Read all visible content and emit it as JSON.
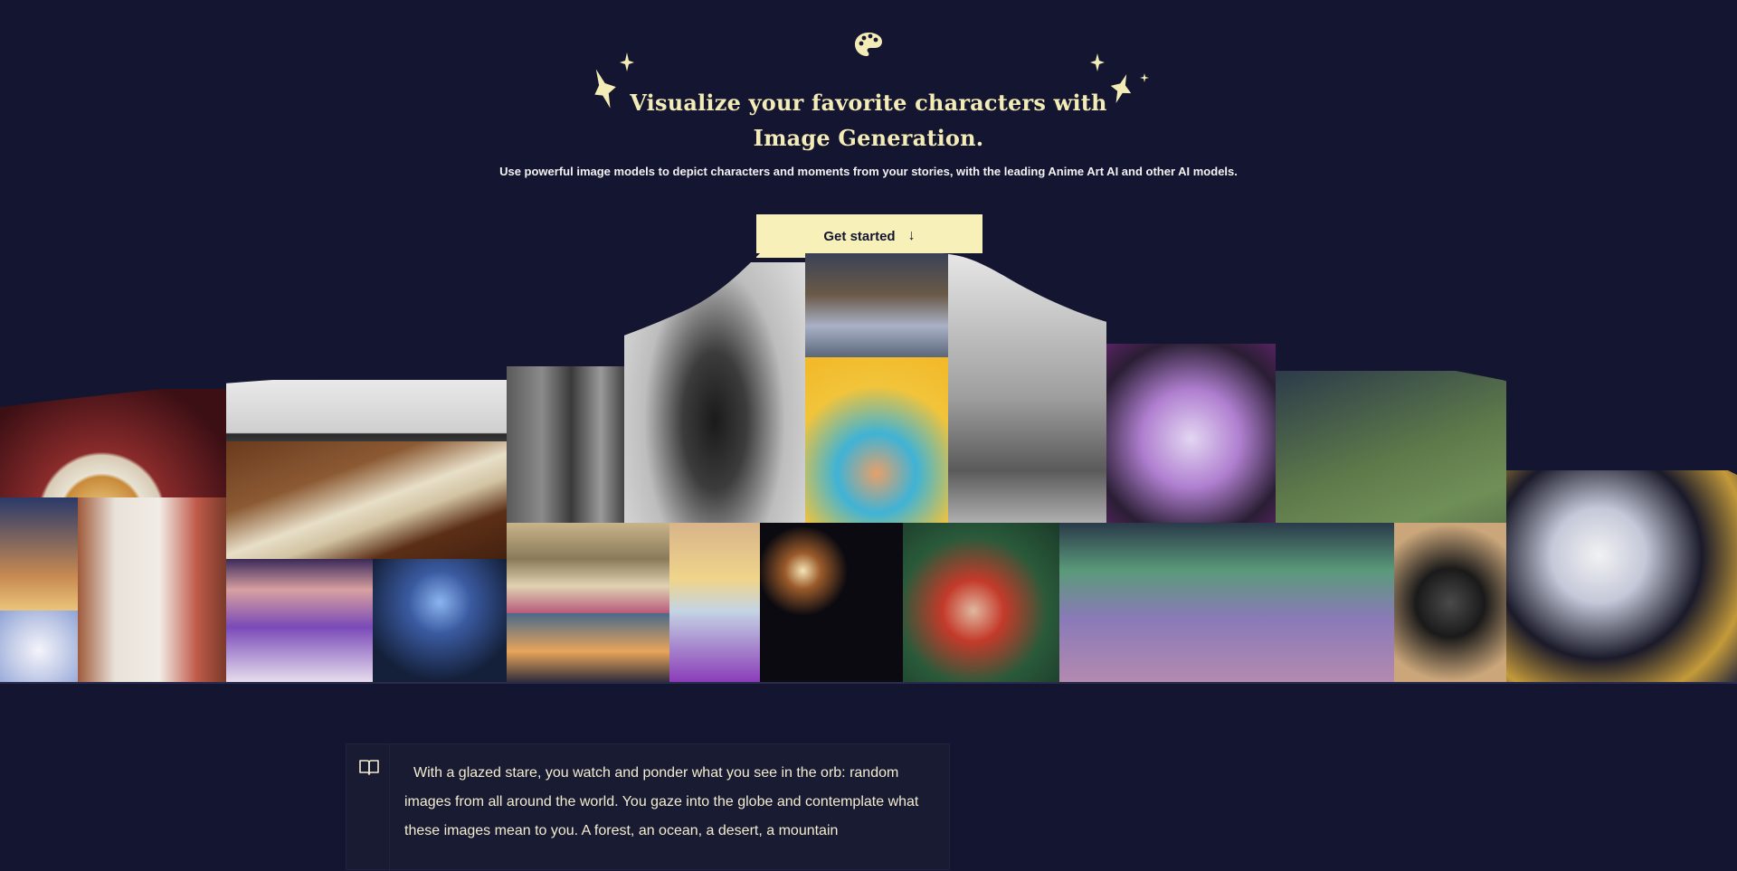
{
  "hero": {
    "title_line1": "Visualize your favorite characters with",
    "title_line2": "Image Generation.",
    "subtitle": "Use powerful image models to depict characters and moments from your stories, with the leading Anime Art AI and other AI models.",
    "cta_label": "Get started",
    "cta_icon": "arrow-down-icon"
  },
  "gallery": {
    "images": [
      "ramen-bowl",
      "horses-sketch",
      "study-desk",
      "rocky-cliffs",
      "armored-warrior-bw",
      "library-corridor",
      "anime-girl-swimming",
      "campfire-forest",
      "silver-haired-woman",
      "soldier-in-green",
      "white-wolf",
      "dragon-sunset",
      "white-haired-girl-chibi",
      "white-haired-girl-kimono",
      "purple-haired-girl",
      "hooded-mage",
      "fairy-palace",
      "sunset-clouds",
      "blonde-girl",
      "fireworks",
      "red-haired-woman",
      "aurora",
      "dark-knight"
    ]
  },
  "colors": {
    "background": "#141530",
    "accent": "#f7f1b9",
    "title": "#f4ecb6"
  },
  "story": {
    "icon": "book-icon",
    "text": "With a glazed stare, you watch and ponder what you see in the orb: random images from all around the world. You gaze into the globe and contemplate what these images mean to you. A forest, an ocean, a desert, a mountain"
  }
}
